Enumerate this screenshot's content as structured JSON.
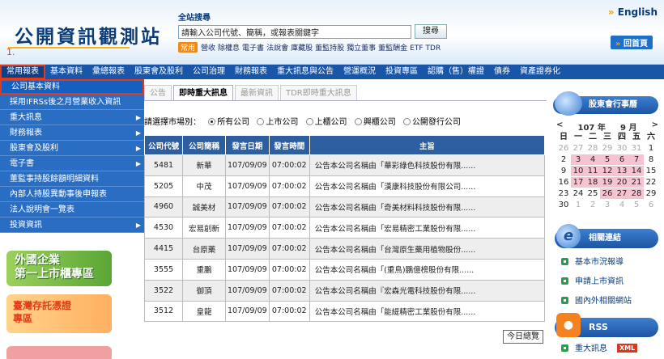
{
  "header": {
    "logo": "公開資訊觀測站",
    "step": "1.",
    "search_title": "全站搜尋",
    "search_placeholder": "請輸入公司代號、簡稱，或報表關鍵字",
    "search_button": "搜尋",
    "quick_tag": "常用",
    "quick_links": [
      "營收",
      "除權息",
      "電子書",
      "法說會",
      "庫藏股",
      "董監持股",
      "獨立董事",
      "董監酬金",
      "ETF",
      "TDR"
    ],
    "english": "English",
    "home": "回首頁"
  },
  "nav": {
    "items": [
      "常用報表",
      "基本資料",
      "彙總報表",
      "股東會及股利",
      "公司治理",
      "財務報表",
      "重大訊息與公告",
      "營運概況",
      "投資專區",
      "認購（售）權證",
      "債券",
      "資產證券化"
    ],
    "selected": 0
  },
  "dropdown": {
    "items": [
      "公司基本資料",
      "採用IFRSs後之月營業收入資訊",
      "重大訊息",
      "財務報表",
      "股東會及股利",
      "電子書",
      "董監事持股餘額明細資料",
      "內部人持股異動事後申報表",
      "法人說明會一覽表",
      "投資資訊"
    ],
    "arrows": [
      false,
      false,
      true,
      true,
      true,
      true,
      false,
      false,
      false,
      true
    ],
    "selected": 0
  },
  "banners": {
    "foreign_line1": "外國企業",
    "foreign_line2": "第一上市櫃專區",
    "tdr_line1": "臺灣存託憑證",
    "tdr_line2": "專區"
  },
  "tabs": {
    "items": [
      "公告",
      "即時重大訊息",
      "最新資訊",
      "TDR即時重大訊息"
    ],
    "active": 1
  },
  "market": {
    "label": "請選擇市場別：",
    "options": [
      "所有公司",
      "上市公司",
      "上櫃公司",
      "興櫃公司",
      "公開發行公司"
    ],
    "selected": 0
  },
  "table": {
    "headers": [
      "公司代號",
      "公司簡稱",
      "發言日期",
      "發言時間",
      "主旨"
    ],
    "rows": [
      [
        "5481",
        "新華",
        "107/09/09",
        "07:00:02",
        "公告本公司名稱由「華彩綠色科技股份有限......"
      ],
      [
        "5205",
        "中茂",
        "107/09/09",
        "07:00:02",
        "公告本公司名稱由「漢康科技股份有限公司......"
      ],
      [
        "4960",
        "誠美材",
        "107/09/09",
        "07:00:02",
        "公告本公司名稱由「奇美材料科技股份有限......"
      ],
      [
        "4530",
        "宏易創新",
        "107/09/09",
        "07:00:02",
        "公告本公司名稱由「宏易精密工業股份有限......"
      ],
      [
        "4415",
        "台原藥",
        "107/09/09",
        "07:00:02",
        "公告本公司名稱由「台灣原生藥用植物股份......"
      ],
      [
        "3555",
        "重鵬",
        "107/09/09",
        "07:00:02",
        "公告本公司名稱由「(重鳥)鵬億榜股份有限......"
      ],
      [
        "3522",
        "御頂",
        "107/09/09",
        "07:00:02",
        "公告本公司名稱由『宏森光電科技股份有限......"
      ],
      [
        "3512",
        "皇龍",
        "107/09/09",
        "07:00:02",
        "公告本公司名稱由「能緹精密工業股份有限......"
      ]
    ],
    "today_button": "今日總覽"
  },
  "calendar": {
    "title": "股東會行事曆",
    "prev": "<",
    "year": "107 年",
    "month": "9 月",
    "next": ">",
    "weekdays": [
      "日",
      "一",
      "二",
      "三",
      "四",
      "五",
      "六"
    ],
    "cells": [
      [
        "26",
        "mute"
      ],
      [
        "27",
        "mute"
      ],
      [
        "28",
        "mute"
      ],
      [
        "29",
        "mute"
      ],
      [
        "30",
        "mute"
      ],
      [
        "31",
        "mute"
      ],
      [
        "1",
        ""
      ],
      [
        "2",
        ""
      ],
      [
        "3",
        "hi"
      ],
      [
        "4",
        "hi"
      ],
      [
        "5",
        "hi"
      ],
      [
        "6",
        "hi"
      ],
      [
        "7",
        "hi"
      ],
      [
        "8",
        ""
      ],
      [
        "9",
        ""
      ],
      [
        "10",
        "hi"
      ],
      [
        "11",
        "hi"
      ],
      [
        "12",
        "hi"
      ],
      [
        "13",
        "hi"
      ],
      [
        "14",
        "hi"
      ],
      [
        "15",
        ""
      ],
      [
        "16",
        ""
      ],
      [
        "17",
        "hi"
      ],
      [
        "18",
        "hi"
      ],
      [
        "19",
        "hi"
      ],
      [
        "20",
        "hi"
      ],
      [
        "21",
        "hi"
      ],
      [
        "22",
        ""
      ],
      [
        "23",
        ""
      ],
      [
        "24",
        ""
      ],
      [
        "25",
        ""
      ],
      [
        "26",
        "hi"
      ],
      [
        "27",
        "hi"
      ],
      [
        "28",
        "hi"
      ],
      [
        "29",
        ""
      ],
      [
        "30",
        ""
      ],
      [
        "1",
        "mute"
      ],
      [
        "2",
        "mute"
      ],
      [
        "3",
        "mute"
      ],
      [
        "4",
        "mute"
      ],
      [
        "5",
        "mute"
      ],
      [
        "6",
        "mute"
      ]
    ]
  },
  "links": {
    "title": "相關連結",
    "items": [
      "基本市況報導",
      "申請上市資訊",
      "國內外相關網站"
    ]
  },
  "rss": {
    "title": "RSS",
    "item": "重大訊息",
    "badge": "XML"
  }
}
